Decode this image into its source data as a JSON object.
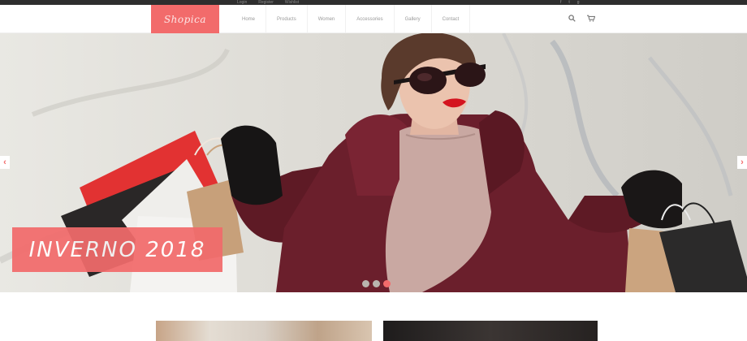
{
  "topbar": {
    "links": [
      "Login",
      "Register",
      "Wishlist"
    ],
    "social": [
      "f",
      "t",
      "g"
    ]
  },
  "header": {
    "logo_text": "Shopica",
    "menu": [
      "Home",
      "Products",
      "Women",
      "Accessories",
      "Gallery",
      "Contact"
    ],
    "search_icon": "search-icon",
    "cart_icon": "cart-icon"
  },
  "hero": {
    "caption": "INVERNO 2018",
    "prev_arrow": "‹",
    "next_arrow": "›",
    "slide_count": 3,
    "active_slide": 3
  },
  "colors": {
    "accent": "#f26b6b",
    "topbar": "#2e2e2e",
    "coat": "#6b1f2c"
  }
}
